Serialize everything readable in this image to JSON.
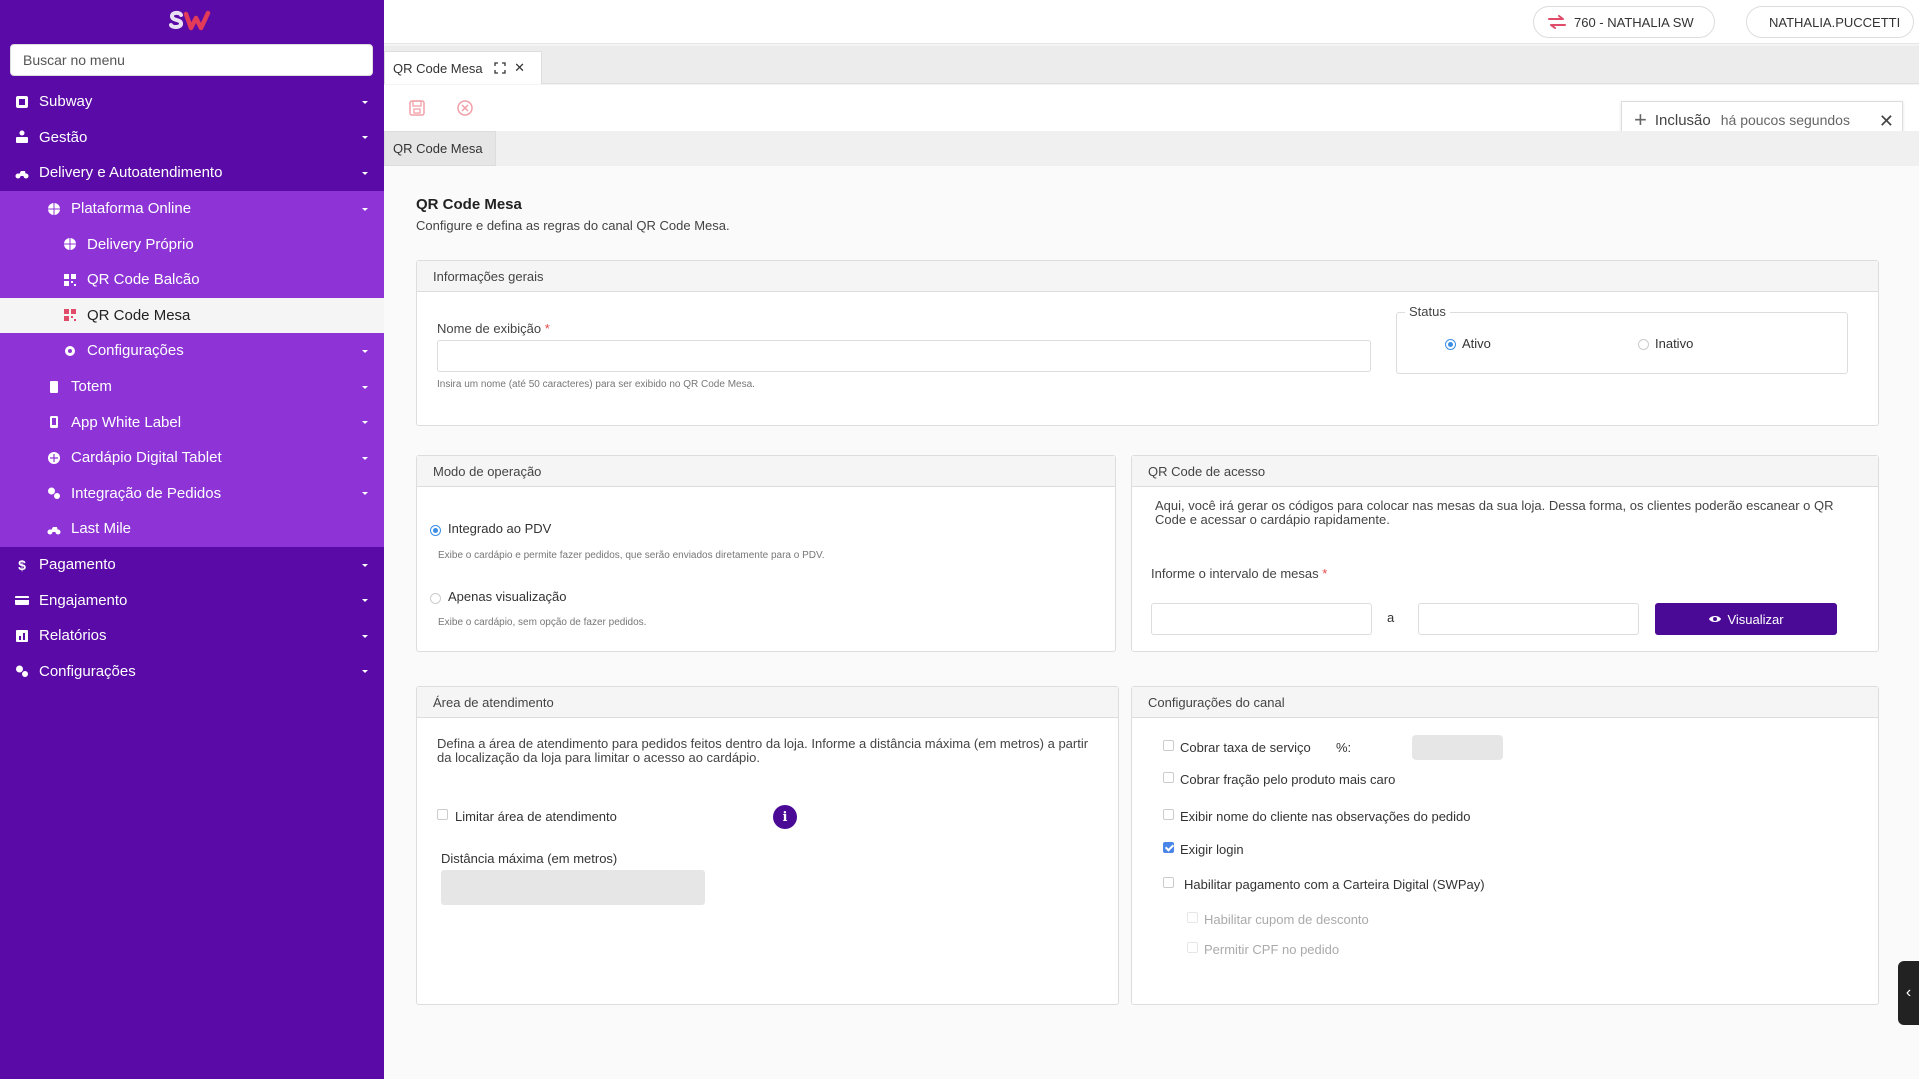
{
  "sidebar": {
    "search_placeholder": "Buscar no menu",
    "items": [
      {
        "label": "Subway",
        "icon": "store-icon"
      },
      {
        "label": "Gestão",
        "icon": "management-icon"
      },
      {
        "label": "Delivery e Autoatendimento",
        "icon": "motorcycle-icon"
      },
      {
        "label": "Plataforma Online",
        "icon": "globe-icon"
      },
      {
        "label": "Delivery Próprio",
        "icon": "globe-icon"
      },
      {
        "label": "QR Code Balcão",
        "icon": "qrcode-icon"
      },
      {
        "label": "QR Code Mesa",
        "icon": "qrcode-icon"
      },
      {
        "label": "Configurações",
        "icon": "gear-icon"
      },
      {
        "label": "Totem",
        "icon": "totem-icon"
      },
      {
        "label": "App White Label",
        "icon": "mobile-icon"
      },
      {
        "label": "Cardápio Digital Tablet",
        "icon": "tablet-icon"
      },
      {
        "label": "Integração de Pedidos",
        "icon": "gears-icon"
      },
      {
        "label": "Last Mile",
        "icon": "motorcycle-icon"
      },
      {
        "label": "Pagamento",
        "icon": "dollar-icon"
      },
      {
        "label": "Engajamento",
        "icon": "card-icon"
      },
      {
        "label": "Relatórios",
        "icon": "report-icon"
      },
      {
        "label": "Configurações",
        "icon": "gears-icon"
      }
    ]
  },
  "topbar": {
    "store": "760 - NATHALIA SW",
    "user": "NATHALIA.PUCCETTI"
  },
  "tabs": [
    {
      "label": "QR Code Mesa"
    }
  ],
  "notification": {
    "action": "Inclusão",
    "time": "há poucos segundos"
  },
  "subtab": "QR Code Mesa",
  "page": {
    "title": "QR Code Mesa",
    "subtitle": "Configure e defina as regras do canal QR Code Mesa."
  },
  "general": {
    "header": "Informações gerais",
    "name_label": "Nome de exibição",
    "required_mark": "*",
    "name_hint": "Insira um nome (até 50 caracteres) para ser exibido no QR Code Mesa.",
    "status_legend": "Status",
    "status_active": "Ativo",
    "status_inactive": "Inativo"
  },
  "operation": {
    "header": "Modo de operação",
    "opt1": "Integrado ao PDV",
    "opt1_desc": "Exibe o cardápio e permite fazer pedidos, que serão enviados diretamente para o PDV.",
    "opt2": "Apenas visualização",
    "opt2_desc": "Exibe o cardápio, sem opção de fazer pedidos."
  },
  "qraccess": {
    "header": "QR Code de acesso",
    "desc": "Aqui, você irá gerar os códigos para colocar nas mesas da sua loja. Dessa forma, os clientes poderão escanear o QR Code e acessar o cardápio rapidamente.",
    "range_label": "Informe o intervalo de mesas",
    "separator": "a",
    "button": "Visualizar"
  },
  "area": {
    "header": "Área de atendimento",
    "desc": "Defina a área de atendimento para pedidos feitos dentro da loja. Informe a distância máxima (em metros) a partir da localização da loja para limitar o acesso ao cardápio.",
    "limit_label": "Limitar área de atendimento",
    "distance_label": "Distância máxima (em metros)"
  },
  "channel": {
    "header": "Configurações do canal",
    "service_fee": "Cobrar taxa de serviço",
    "percent": "%:",
    "fraction": "Cobrar fração pelo produto mais caro",
    "show_name": "Exibir nome do cliente nas observações do pedido",
    "require_login": "Exigir login",
    "swpay": "Habilitar pagamento com a Carteira Digital (SWPay)",
    "coupon": "Habilitar cupom de desconto",
    "cpf": "Permitir CPF no pedido"
  }
}
